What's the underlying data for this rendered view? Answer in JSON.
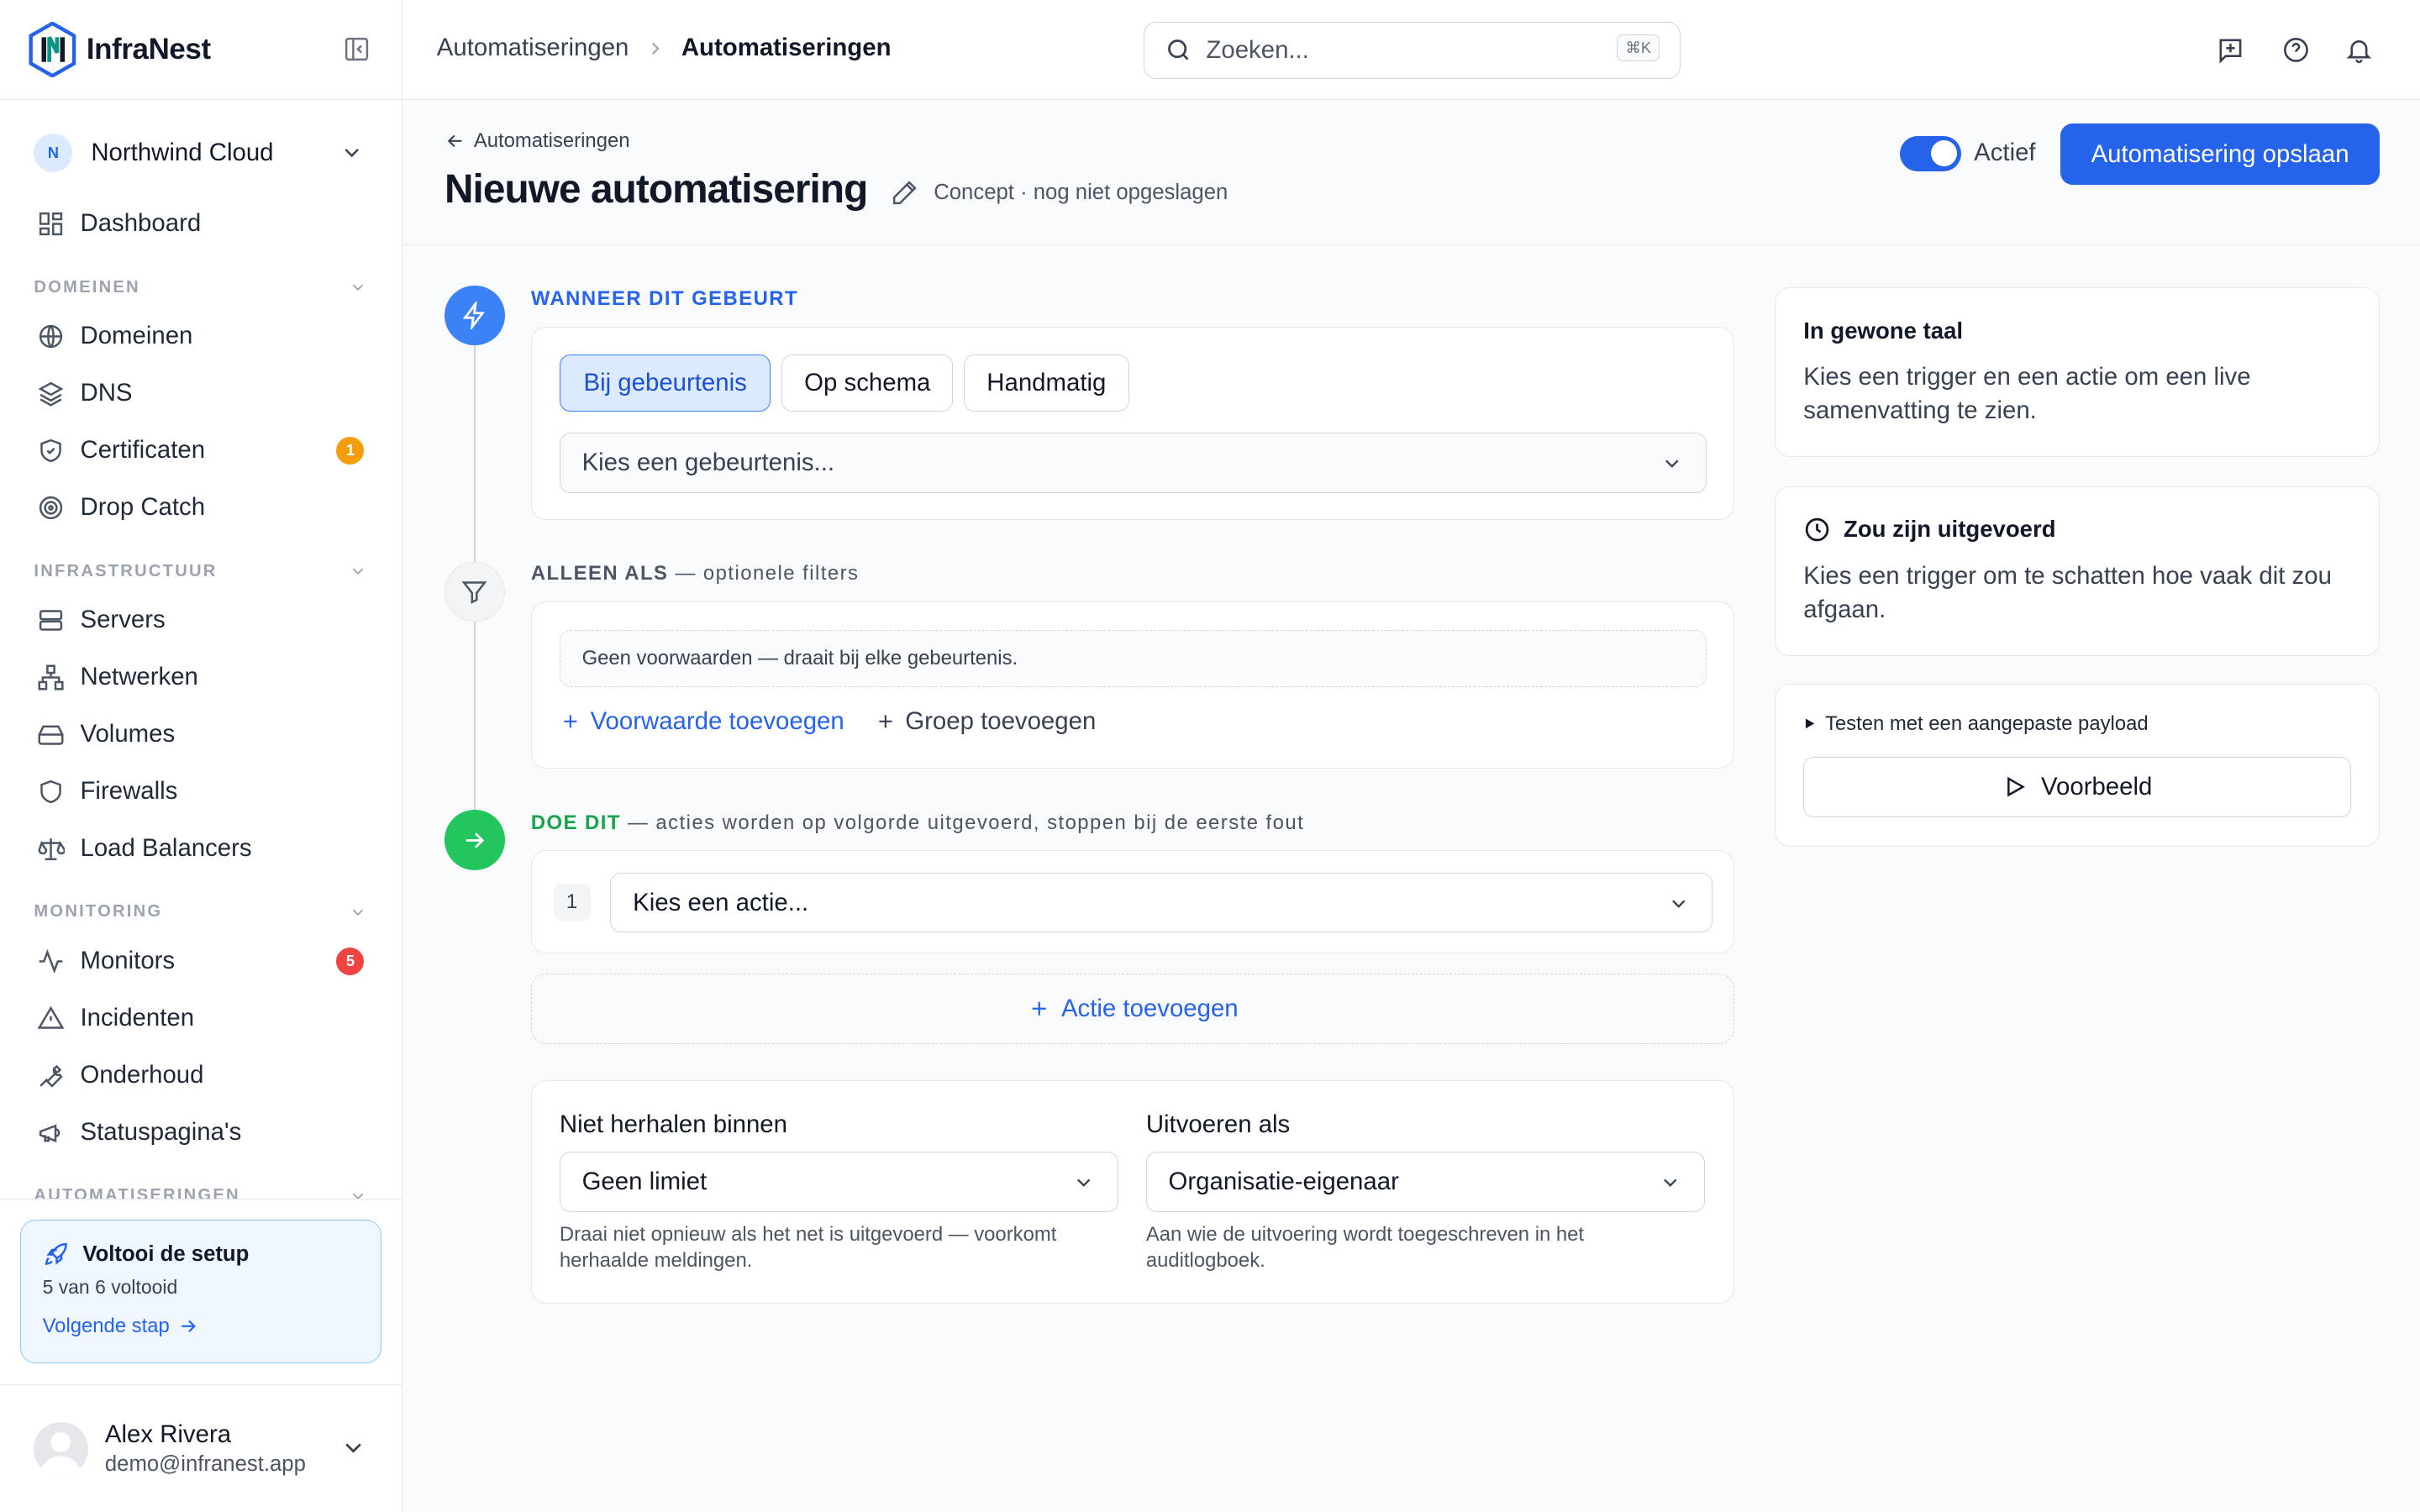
{
  "app": {
    "name": "InfraNest"
  },
  "org": {
    "initial": "N",
    "name": "Northwind Cloud"
  },
  "nav": {
    "dashboard": "Dashboard",
    "sections": {
      "domains": "DOMEINEN",
      "infra": "INFRASTRUCTUUR",
      "monitoring": "MONITORING",
      "automations": "AUTOMATISERINGEN"
    },
    "items": {
      "domains": "Domeinen",
      "dns": "DNS",
      "certificates": "Certificaten",
      "dropcatch": "Drop Catch",
      "servers": "Servers",
      "networks": "Netwerken",
      "volumes": "Volumes",
      "firewalls": "Firewalls",
      "loadbalancers": "Load Balancers",
      "monitors": "Monitors",
      "incidents": "Incidenten",
      "maintenance": "Onderhoud",
      "statuspages": "Statuspagina's"
    },
    "badges": {
      "certificates": "1",
      "monitors": "5"
    },
    "badge_colors": {
      "certificates": "#f59e0b",
      "monitors": "#ef4444"
    }
  },
  "setup": {
    "title": "Voltooi de setup",
    "progress": "5 van 6 voltooid",
    "progress_fraction": 0.8333,
    "link": "Volgende stap"
  },
  "user": {
    "name": "Alex Rivera",
    "email": "demo@infranest.app"
  },
  "topbar": {
    "breadcrumb": [
      "Automatiseringen",
      "Automatiseringen"
    ],
    "search_placeholder": "Zoeken...",
    "search_shortcut": "⌘K"
  },
  "header": {
    "back": "Automatiseringen",
    "title": "Nieuwe automatisering",
    "status": "Concept · nog niet opgeslagen",
    "active_label": "Actief",
    "active": true,
    "save": "Automatisering opslaan"
  },
  "trigger": {
    "heading": "WANNEER DIT GEBEURT",
    "tabs": [
      "Bij gebeurtenis",
      "Op schema",
      "Handmatig"
    ],
    "selected_tab": "Bij gebeurtenis",
    "select_placeholder": "Kies een gebeurtenis..."
  },
  "filters": {
    "heading": "ALLEEN ALS",
    "heading_suffix": " — optionele filters",
    "empty": "Geen voorwaarden — draait bij elke gebeurtenis.",
    "add_condition": "Voorwaarde toevoegen",
    "add_group": "Groep toevoegen"
  },
  "actions": {
    "heading": "DOE DIT",
    "heading_suffix": " — acties worden op volgorde uitgevoerd, stoppen bij de eerste fout",
    "step_number": "1",
    "select_placeholder": "Kies een actie...",
    "add_action": "Actie toevoegen"
  },
  "options": {
    "throttle_label": "Niet herhalen binnen",
    "throttle_value": "Geen limiet",
    "throttle_help": "Draai niet opnieuw als het net is uitgevoerd — voorkomt herhaalde meldingen.",
    "run_as_label": "Uitvoeren als",
    "run_as_value": "Organisatie-eigenaar",
    "run_as_help": "Aan wie de uitvoering wordt toegeschreven in het auditlogboek."
  },
  "summary": {
    "plain_title": "In gewone taal",
    "plain_body": "Kies een trigger en een actie om een live samenvatting te zien.",
    "would_run_title": "Zou zijn uitgevoerd",
    "would_run_body": "Kies een trigger om te schatten hoe vaak dit zou afgaan.",
    "test_toggle": "Testen met een aangepaste payload",
    "preview": "Voorbeeld"
  },
  "colors": {
    "accent": "#2563eb",
    "trigger_step": "#3b82f6",
    "action_step": "#22c55e"
  }
}
